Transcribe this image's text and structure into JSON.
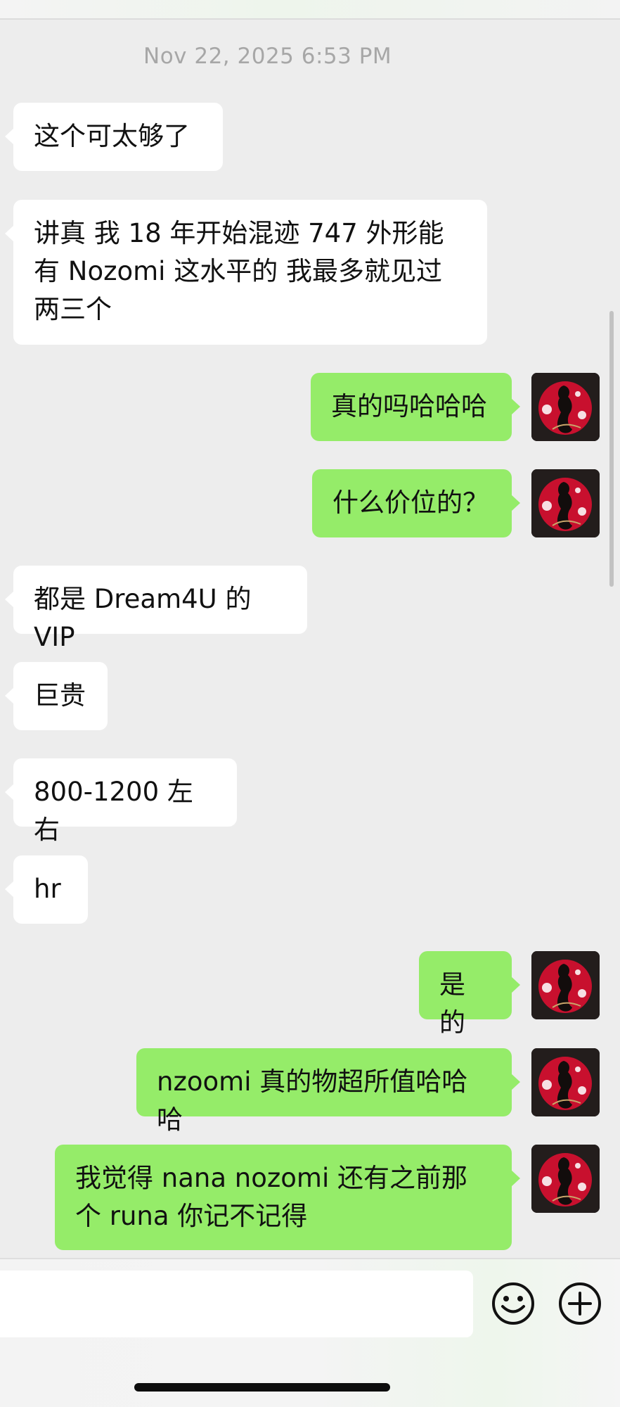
{
  "chat": {
    "timestamp": "Nov 22, 2025 6:53 PM",
    "messages": [
      {
        "side": "left",
        "text": "这个可太够了"
      },
      {
        "side": "left",
        "text": "讲真 我 18 年开始混迹 747 外形能有 Nozomi 这水平的 我最多就见过两三个"
      },
      {
        "side": "right",
        "text": "真的吗哈哈哈"
      },
      {
        "side": "right",
        "text": "什么价位的？"
      },
      {
        "side": "left",
        "text": "都是 Dream4U 的 VIP"
      },
      {
        "side": "left",
        "text": "巨贵"
      },
      {
        "side": "left",
        "text": "800-1200 左右"
      },
      {
        "side": "left",
        "text": "hr"
      },
      {
        "side": "right",
        "text": "是的"
      },
      {
        "side": "right",
        "text": "nzoomi 真的物超所值哈哈哈"
      },
      {
        "side": "right",
        "text": "我觉得 nana nozomi 还有之前那个 runa 你记不记得"
      }
    ]
  },
  "input_bar": {
    "emoji_icon": "emoji-smile-icon",
    "more_icon": "plus-circle-icon"
  },
  "colors": {
    "background": "#ededed",
    "incoming_bubble": "#ffffff",
    "outgoing_bubble": "#95ec69",
    "timestamp_text": "#a7a7a7"
  }
}
